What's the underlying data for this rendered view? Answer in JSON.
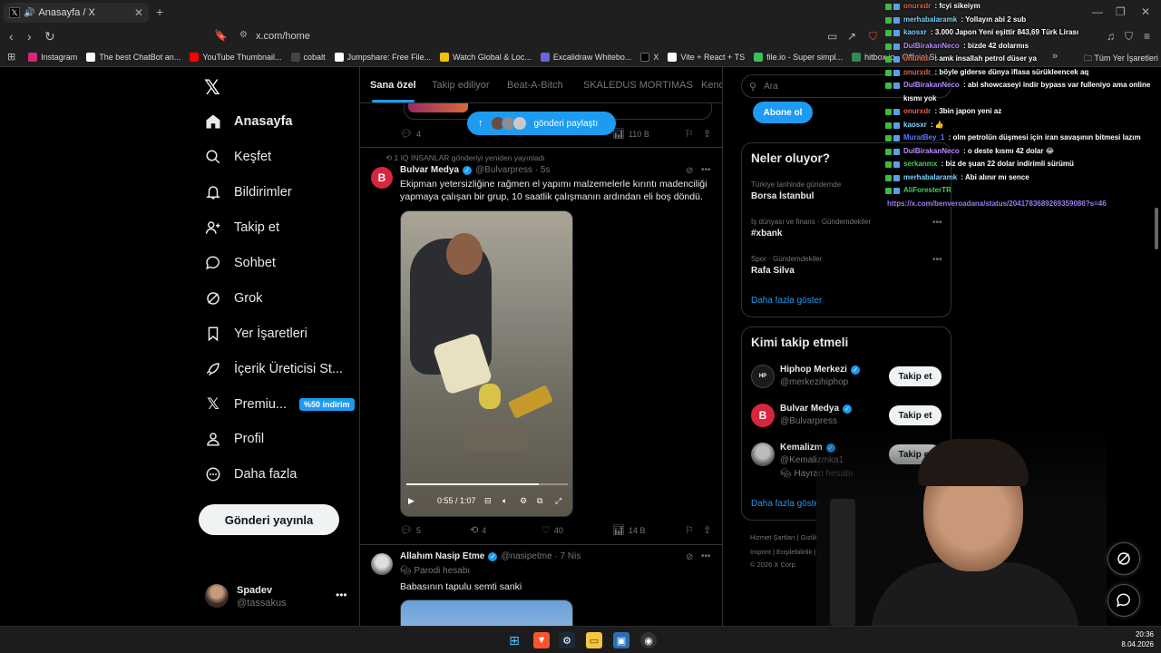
{
  "browser": {
    "tab_title": "Anasayfa / X",
    "url": "x.com/home",
    "bookmarks": [
      {
        "label": "Instagram",
        "color": "#d6297a"
      },
      {
        "label": "The best ChatBot an...",
        "color": "#ffffff"
      },
      {
        "label": "YouTube Thumbnail...",
        "color": "#ff0000"
      },
      {
        "label": "cobalt",
        "color": "#444444"
      },
      {
        "label": "Jumpshare: Free File...",
        "color": "#ffffff"
      },
      {
        "label": "Watch Global & Loc...",
        "color": "#f2c200"
      },
      {
        "label": "Excalidraw Whitebo...",
        "color": "#6965db"
      },
      {
        "label": "X",
        "color": "#000000"
      },
      {
        "label": "Vite + React + TS",
        "color": "#ffffff"
      },
      {
        "label": "file.io - Super simpl...",
        "color": "#36c25a"
      },
      {
        "label": "hitbox.io - Official Si...",
        "color": "#2e8b57"
      }
    ],
    "all_bookmarks": "Tüm Yer İşaretleri"
  },
  "nav": {
    "items": [
      {
        "label": "Anasayfa",
        "icon": "home-icon"
      },
      {
        "label": "Keşfet",
        "icon": "search-icon"
      },
      {
        "label": "Bildirimler",
        "icon": "bell-icon"
      },
      {
        "label": "Takip et",
        "icon": "add-person-icon"
      },
      {
        "label": "Sohbet",
        "icon": "chat-icon"
      },
      {
        "label": "Grok",
        "icon": "grok-icon"
      },
      {
        "label": "Yer İşaretleri",
        "icon": "bookmark-icon"
      },
      {
        "label": "İçerik Üreticisi St...",
        "icon": "rocket-icon"
      },
      {
        "label": "Premiu...",
        "icon": "x-logo-icon"
      },
      {
        "label": "Profil",
        "icon": "person-icon"
      },
      {
        "label": "Daha fazla",
        "icon": "more-circle-icon"
      }
    ],
    "premium_badge": "%50 indirim",
    "post_button": "Gönderi yayınla",
    "account": {
      "name": "Spadev",
      "handle": "@tassakus"
    }
  },
  "timeline": {
    "tabs": [
      "Sana özel",
      "Takip ediliyor",
      "Beat-A-Bitch",
      "SKALEDUS MORTIMAS",
      "Kend"
    ],
    "new_posts_pill": "gönderi paylaştı",
    "prev_post_actions": {
      "replies": "4",
      "views": "110 B"
    },
    "repost_note": "1 IQ İNSANLAR gönderiyi yeniden yayınladı",
    "post1": {
      "name": "Bulvar Medya",
      "handle": "@Bulvarpress",
      "time": "5s",
      "text": "Ekipman yetersizliğine rağmen el yapımı malzemelerle kırıntı madenciliği yapmaya çalışan bir grup, 10 saatlik çalışmanın ardından eli boş döndü.",
      "video_time": "0:55 / 1:07",
      "video_progress": 0.82,
      "replies": "5",
      "reposts": "4",
      "likes": "40",
      "views": "14 B"
    },
    "post2": {
      "name": "Allahım Nasip Etme",
      "handle": "@nasipetme",
      "time": "7 Nis",
      "label": "Parodi hesabı",
      "text": "Babasının tapulu semti sanki"
    }
  },
  "sidebar": {
    "search_placeholder": "Ara",
    "subscribe_button": "Abone ol",
    "trends_title": "Neler oluyor?",
    "trends": [
      {
        "category": "Türkiye tarihinde gündemde",
        "name": "Borsa İstanbul"
      },
      {
        "category": "İş dünyası ve finans · Gündemdekiler",
        "name": "#xbank"
      },
      {
        "category": "Spor · Gündemdekiler",
        "name": "Rafa Silva"
      }
    ],
    "show_more": "Daha fazla göster",
    "who_to_follow_title": "Kimi takip etmeli",
    "who_to_follow": [
      {
        "name": "Hiphop Merkezi",
        "handle": "@merkezihiphop",
        "extra": ""
      },
      {
        "name": "Bulvar Medya",
        "handle": "@Bulvarpress",
        "extra": ""
      },
      {
        "name": "Kemalizm",
        "handle": "@Kemalizmka1",
        "extra": "Hayran hesabı"
      }
    ],
    "follow_button": "Takip et",
    "footer_line1": "Hizmet Şartları   |   Gizlilik Politik",
    "footer_line2": "Imprint   |   Erişilebilirlik   |   Rek",
    "footer_line3": "© 2026 X Corp."
  },
  "chat": [
    {
      "user": "onurxdr",
      "msg": "fcyi sikeiym",
      "color": "#e0624a"
    },
    {
      "user": "merhabalaramk",
      "msg": "Yollayın abi 2 sub",
      "color": "#7bd3ff"
    },
    {
      "user": "kaosxr",
      "msg": "3.000 Japon Yeni eşittir 843,69 Türk Lirası",
      "color": "#7bd3ff"
    },
    {
      "user": "DulBirakanNeco",
      "msg": "bizde 42 dolarmıs",
      "color": "#b48cff"
    },
    {
      "user": "onurxdr",
      "msg": "amk insallah petrol düser ya",
      "color": "#e0624a"
    },
    {
      "user": "onurxdr",
      "msg": "böyle giderse dünya iflasa sürükleencek aq",
      "color": "#e0624a"
    },
    {
      "user": "DulBirakanNeco",
      "msg": "abi showcaseyi indir bypass var fulleniyo ama online kısmı yok",
      "color": "#b48cff"
    },
    {
      "user": "onurxdr",
      "msg": "3bin japon yeni az",
      "color": "#e0624a"
    },
    {
      "user": "kaosxr",
      "msg": "👍",
      "color": "#7bd3ff"
    },
    {
      "user": "MuratBey_1",
      "msg": "olm petrolün düşmesi için iran savaşının bitmesi lazım",
      "color": "#5a7bff"
    },
    {
      "user": "DulBirakanNeco",
      "msg": "o deste kısmı 42 dolar 😂",
      "color": "#b48cff"
    },
    {
      "user": "serkanmx",
      "msg": "biz de şuan 22 dolar indirimli sürümü",
      "color": "#3ad15a"
    },
    {
      "user": "merhabalaramk",
      "msg": "Abi alınır mı sence",
      "color": "#7bd3ff"
    },
    {
      "user": "AliForesterTR",
      "msg": "",
      "color": "#3ad15a"
    }
  ],
  "chat_link": "https://x.com/benveroadana/status/2041783689269359086?s=46",
  "taskbar": {
    "time": "20:36",
    "date": "8.04.2026"
  }
}
